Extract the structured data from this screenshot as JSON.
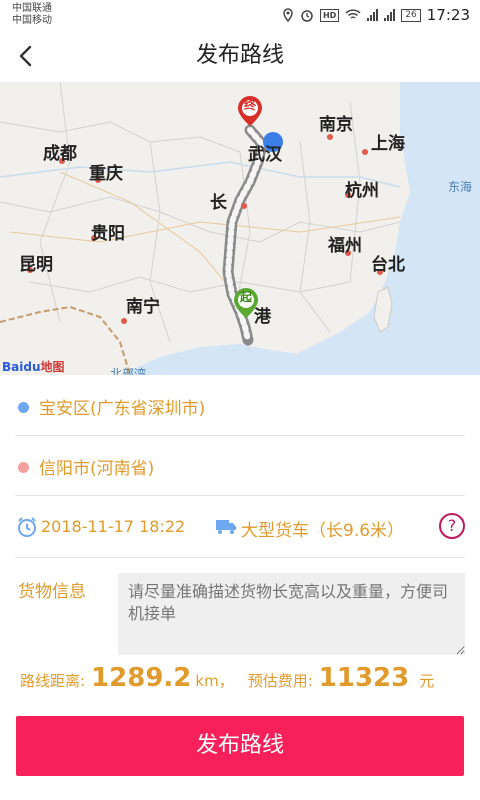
{
  "status_bar": {
    "carrier1": "中国联通",
    "carrier2": "中国移动",
    "hd": "HD",
    "battery": "26",
    "time": "17:23"
  },
  "header": {
    "title": "发布路线"
  },
  "map": {
    "cities": {
      "chengdu": "成都",
      "chongqing": "重庆",
      "guiyang": "贵阳",
      "kunming": "昆明",
      "nanning": "南宁",
      "nanjing": "南京",
      "shanghai": "上海",
      "hangzhou": "杭州",
      "fuzhou": "福州",
      "taibei": "台北",
      "wuhan": "武汉",
      "changsha": "长",
      "xianggang": "港",
      "beibuwan": "北部湾"
    },
    "sea": "东海",
    "start_marker": "起",
    "end_marker": "终",
    "logo_text": "Bai",
    "logo_text2": "du",
    "logo_suffix": "地图"
  },
  "route": {
    "origin": "宝安区(广东省深圳市)",
    "destination": "信阳市(河南省)",
    "origin_dot_color": "#6ea8f0",
    "destination_dot_color": "#f3a0a0"
  },
  "trip": {
    "datetime": "2018-11-17 18:22",
    "vehicle": "大型货车（长9.6米）",
    "help": "?"
  },
  "goods": {
    "label": "货物信息",
    "placeholder": "请尽量准确描述货物长宽高以及重量，方便司机接单"
  },
  "summary": {
    "distance_label": "路线距离:",
    "distance_value": "1289.2",
    "distance_unit": "km，",
    "cost_label": "预估费用:",
    "cost_value": "11323",
    "cost_unit": "元"
  },
  "publish_button": "发布路线",
  "colors": {
    "accent": "#f7205a",
    "text_orange": "#e09b2c"
  }
}
